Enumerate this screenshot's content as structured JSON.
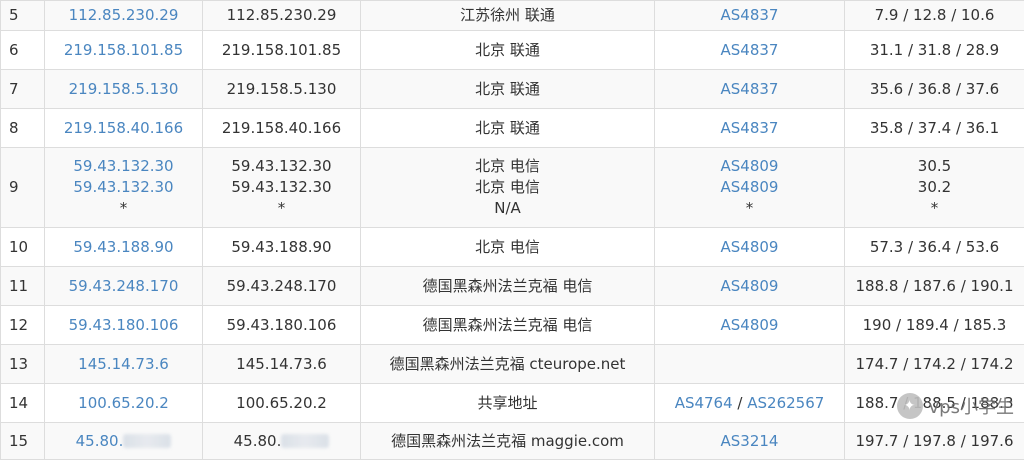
{
  "rows": [
    {
      "hop": "5",
      "ip_link": [
        "112.85.230.29"
      ],
      "ip": [
        "112.85.230.29"
      ],
      "loc": [
        "江苏徐州 联通"
      ],
      "asn": [
        "AS4837"
      ],
      "rtt": [
        "7.9 / 12.8 / 10.6"
      ]
    },
    {
      "hop": "6",
      "ip_link": [
        "219.158.101.85"
      ],
      "ip": [
        "219.158.101.85"
      ],
      "loc": [
        "北京 联通"
      ],
      "asn": [
        "AS4837"
      ],
      "rtt": [
        "31.1 / 31.8 / 28.9"
      ]
    },
    {
      "hop": "7",
      "ip_link": [
        "219.158.5.130"
      ],
      "ip": [
        "219.158.5.130"
      ],
      "loc": [
        "北京 联通"
      ],
      "asn": [
        "AS4837"
      ],
      "rtt": [
        "35.6 / 36.8 / 37.6"
      ]
    },
    {
      "hop": "8",
      "ip_link": [
        "219.158.40.166"
      ],
      "ip": [
        "219.158.40.166"
      ],
      "loc": [
        "北京 联通"
      ],
      "asn": [
        "AS4837"
      ],
      "rtt": [
        "35.8 / 37.4 / 36.1"
      ]
    },
    {
      "hop": "9",
      "ip_link": [
        "59.43.132.30",
        "59.43.132.30",
        "*"
      ],
      "ip": [
        "59.43.132.30",
        "59.43.132.30",
        "*"
      ],
      "loc": [
        "北京 电信",
        "北京 电信",
        "N/A"
      ],
      "asn": [
        "AS4809",
        "AS4809",
        "*"
      ],
      "rtt": [
        "30.5",
        "30.2",
        "*"
      ]
    },
    {
      "hop": "10",
      "ip_link": [
        "59.43.188.90"
      ],
      "ip": [
        "59.43.188.90"
      ],
      "loc": [
        "北京 电信"
      ],
      "asn": [
        "AS4809"
      ],
      "rtt": [
        "57.3 / 36.4 / 53.6"
      ]
    },
    {
      "hop": "11",
      "ip_link": [
        "59.43.248.170"
      ],
      "ip": [
        "59.43.248.170"
      ],
      "loc": [
        "德国黑森州法兰克福 电信"
      ],
      "asn": [
        "AS4809"
      ],
      "rtt": [
        "188.8 / 187.6 / 190.1"
      ]
    },
    {
      "hop": "12",
      "ip_link": [
        "59.43.180.106"
      ],
      "ip": [
        "59.43.180.106"
      ],
      "loc": [
        "德国黑森州法兰克福 电信"
      ],
      "asn": [
        "AS4809"
      ],
      "rtt": [
        "190 / 189.4 / 185.3"
      ]
    },
    {
      "hop": "13",
      "ip_link": [
        "145.14.73.6"
      ],
      "ip": [
        "145.14.73.6"
      ],
      "loc": [
        "德国黑森州法兰克福 cteurope.net"
      ],
      "asn": [
        ""
      ],
      "rtt": [
        "174.7 / 174.2 / 174.2"
      ]
    },
    {
      "hop": "14",
      "ip_link": [
        "100.65.20.2"
      ],
      "ip": [
        "100.65.20.2"
      ],
      "loc": [
        "共享地址"
      ],
      "asn": [
        "AS4764 / AS262567"
      ],
      "asn_parts": [
        "AS4764",
        "AS262567"
      ],
      "rtt": [
        "188.7 / 188.5 / 188.3"
      ]
    },
    {
      "hop": "15",
      "ip_link": [
        "45.80."
      ],
      "ip": [
        "45.80."
      ],
      "loc": [
        "德国黑森州法兰克福 maggie.com"
      ],
      "asn": [
        "AS3214"
      ],
      "rtt": [
        "197.7 / 197.8 / 197.6"
      ],
      "redacted": true
    }
  ],
  "watermark": {
    "text": "vps小学生"
  },
  "colors": {
    "link": "#4a86c0",
    "border": "#dddddd",
    "row_alt": "#f9f9f9"
  }
}
